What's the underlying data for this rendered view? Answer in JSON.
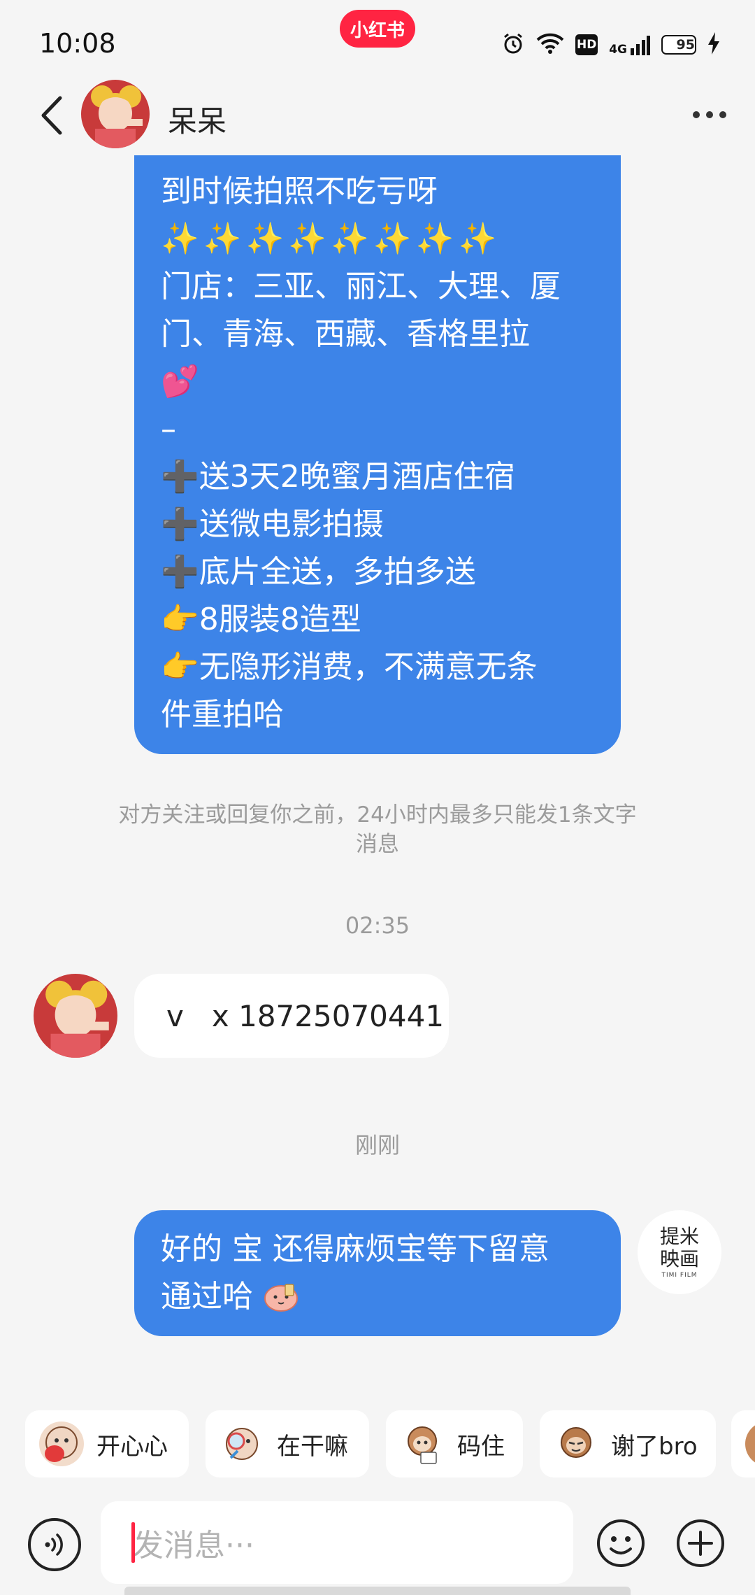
{
  "status_bar": {
    "time": "10:08",
    "app_badge": "小红书",
    "hd_label": "HD",
    "network_label": "4G",
    "battery_level": "95"
  },
  "header": {
    "contact_name": "呆呆"
  },
  "messages": {
    "promo": {
      "lines": [
        "到时候拍照不吃亏呀",
        "✨✨✨✨✨✨✨✨",
        "门店：三亚、丽江、大理、厦",
        "门、青海、西藏、香格里拉",
        "💕",
        "–",
        "➕送3天2晚蜜月酒店住宿",
        "➕送微电影拍摄",
        "➕底片全送，多拍多送",
        "👉8服装8造型",
        "👉无隐形消费，不满意无条",
        "件重拍哈"
      ]
    },
    "notice_line1": "对方关注或回复你之前，24小时内最多只能发1条文字",
    "notice_line2": "消息",
    "timestamp_1": "02:35",
    "received_text": "v   x 18725070441",
    "timestamp_2": "刚刚",
    "reply_line1": "好的  宝  还得麻烦宝等下留意",
    "reply_line2": "通过哈"
  },
  "self_avatar": {
    "logo_cn_1": "提米",
    "logo_cn_2": "映画",
    "logo_en": "TIMI FILM"
  },
  "stickers": [
    {
      "label": "开心心",
      "icon": "happy-monkey-sticker"
    },
    {
      "label": "在干嘛",
      "icon": "magnifier-monkey-sticker"
    },
    {
      "label": "码住",
      "icon": "note-monkey-sticker"
    },
    {
      "label": "谢了bro",
      "icon": "thanks-monkey-sticker"
    }
  ],
  "input": {
    "placeholder": "发消息···"
  },
  "colors": {
    "brand": "#ff2442",
    "bubble_blue": "#3d84e8",
    "background": "#f5f5f5"
  }
}
